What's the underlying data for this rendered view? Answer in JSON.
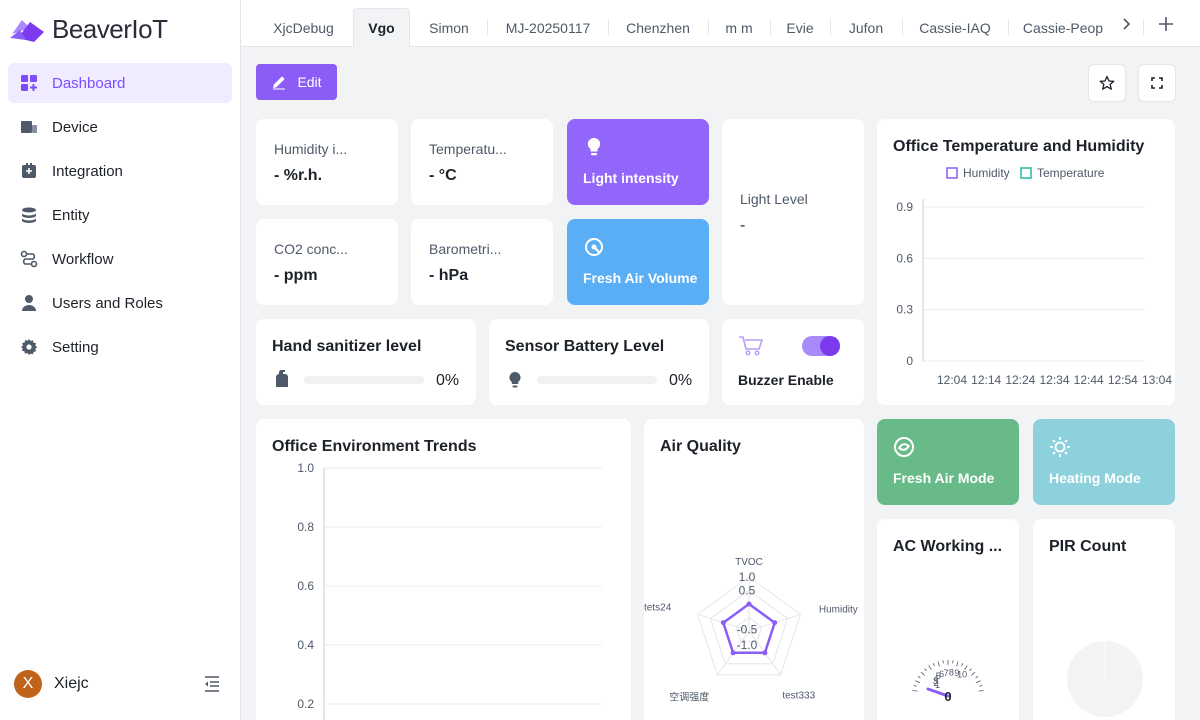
{
  "app": {
    "name": "BeaverIoT"
  },
  "sidebar": {
    "items": [
      {
        "label": "Dashboard",
        "icon": "dashboard-icon",
        "active": true
      },
      {
        "label": "Device",
        "icon": "device-icon"
      },
      {
        "label": "Integration",
        "icon": "integration-icon"
      },
      {
        "label": "Entity",
        "icon": "entity-icon"
      },
      {
        "label": "Workflow",
        "icon": "workflow-icon"
      },
      {
        "label": "Users and Roles",
        "icon": "user-icon"
      },
      {
        "label": "Setting",
        "icon": "gear-icon"
      }
    ],
    "user": {
      "initial": "X",
      "name": "Xiejc"
    }
  },
  "tabs": [
    {
      "label": "XjcDebug"
    },
    {
      "label": "Vgo",
      "active": true
    },
    {
      "label": "Simon"
    },
    {
      "label": "MJ-20250117"
    },
    {
      "label": "Chenzhen"
    },
    {
      "label": "m m"
    },
    {
      "label": "Evie"
    },
    {
      "label": "Jufon"
    },
    {
      "label": "Cassie-IAQ"
    },
    {
      "label": "Cassie-Peop"
    }
  ],
  "toolbar": {
    "edit_label": "Edit"
  },
  "widgets": {
    "humidity": {
      "label": "Humidity i...",
      "value": "- %r.h."
    },
    "temperature": {
      "label": "Temperatu...",
      "value": "- °C"
    },
    "co2": {
      "label": "CO2 conc...",
      "value": "- ppm"
    },
    "barometric": {
      "label": "Barometri...",
      "value": "- hPa"
    },
    "light_intensity": {
      "label": "Light intensity"
    },
    "fresh_air_volume": {
      "label": "Fresh Air Volume"
    },
    "light_level": {
      "label": "Light Level",
      "value": "-"
    },
    "hand_sanitizer": {
      "title": "Hand sanitizer level",
      "percent_text": "0%",
      "percent": 0
    },
    "sensor_battery": {
      "title": "Sensor Battery Level",
      "percent_text": "0%",
      "percent": 0
    },
    "buzzer": {
      "label": "Buzzer Enable",
      "enabled": true
    },
    "fresh_air_mode": {
      "label": "Fresh Air Mode"
    },
    "heating_mode": {
      "label": "Heating Mode"
    },
    "ac_working": {
      "title": "AC Working ..."
    },
    "pir_count": {
      "title": "PIR Count"
    }
  },
  "colors": {
    "accent": "#8b5cf6",
    "light_intensity_tile": "#9266fb",
    "fresh_air_volume_tile": "#5aaef5",
    "fresh_air_mode_tile": "#68bb88",
    "heating_mode_tile": "#8dd1dd",
    "humidity_series": "#8b5cf6",
    "temperature_series": "#26b7a4"
  },
  "chart_data": [
    {
      "type": "line",
      "title": "Office Temperature and Humidity",
      "x": [
        "12:04",
        "12:14",
        "12:24",
        "12:34",
        "12:44",
        "12:54",
        "13:04"
      ],
      "series": [
        {
          "name": "Humidity",
          "values": []
        },
        {
          "name": "Temperature",
          "values": []
        }
      ],
      "y_ticks": [
        "0",
        "0.3",
        "0.6",
        "0.9"
      ],
      "ylim": [
        0,
        0.9
      ],
      "legend": "top-center",
      "grid": true
    },
    {
      "type": "line",
      "title": "Office Environment Trends",
      "x": [],
      "series": [],
      "y_ticks": [
        "0.2",
        "0.4",
        "0.6",
        "0.8",
        "1.0"
      ],
      "ylim": [
        0,
        1.0
      ],
      "grid": true
    },
    {
      "type": "radar",
      "title": "Air Quality",
      "indicators": [
        "TVOC",
        "Humidity",
        "test333",
        "空调强度",
        "tets24"
      ],
      "radial_ticks": [
        "1.0",
        "0.5",
        "-0.5",
        "-1.0"
      ],
      "values": [
        0,
        0,
        0,
        0,
        0
      ],
      "range": [
        -1.0,
        1.0
      ]
    },
    {
      "type": "gauge",
      "title": "AC Working ...",
      "value_text": "0",
      "scale_labels": [
        "1",
        "2",
        "3",
        "4",
        "5",
        "6",
        "7",
        "8",
        "9",
        "10"
      ],
      "value": 0,
      "range": [
        0,
        10
      ]
    },
    {
      "type": "pie",
      "title": "PIR Count",
      "values": []
    }
  ]
}
